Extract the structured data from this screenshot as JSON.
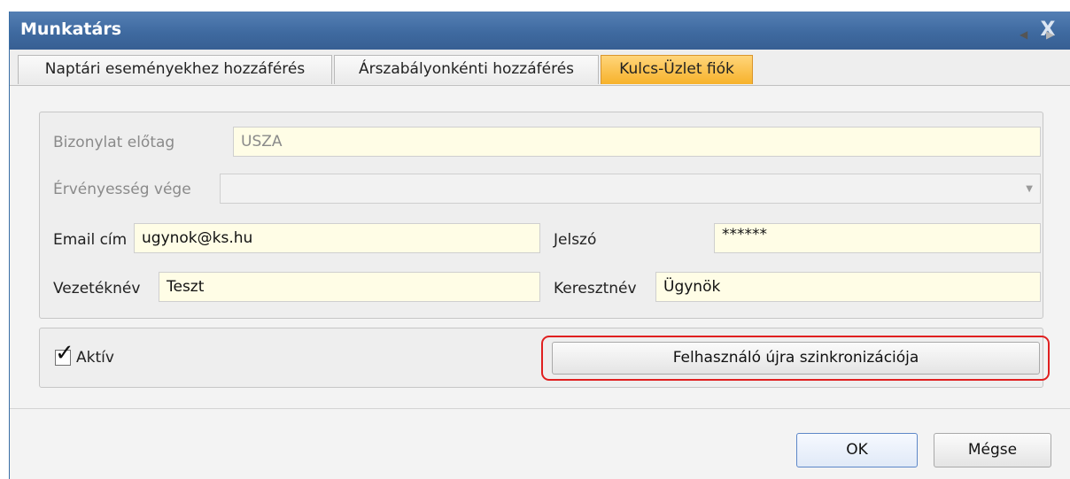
{
  "window": {
    "title": "Munkatárs",
    "close_glyph": "X"
  },
  "tabs": [
    {
      "label": "Naptári eseményekhez hozzáférés",
      "active": false
    },
    {
      "label": "Árszabályonkénti hozzáférés",
      "active": false
    },
    {
      "label": "Kulcs-Üzlet fiók",
      "active": true
    }
  ],
  "tab_nav": {
    "prev_icon": "triangle-left-icon",
    "next_icon": "triangle-right-icon",
    "prev_glyph": "◀",
    "next_glyph": "▶"
  },
  "form": {
    "prefix_label": "Bizonylat előtag",
    "prefix_value": "USZA",
    "validity_label": "Érvényesség vége",
    "validity_value": "",
    "validity_arrow": "▼",
    "email_label": "Email cím",
    "email_value": "ugynok@ks.hu",
    "password_label": "Jelszó",
    "password_value": "******",
    "lastname_label": "Vezetéknév",
    "lastname_value": "Teszt",
    "firstname_label": "Keresztnév",
    "firstname_value": "Ügynök"
  },
  "options": {
    "active_label": "Aktív",
    "active_checked": true,
    "check_glyph": "✓",
    "resync_button": "Felhasználó újra szinkronizációja"
  },
  "footer": {
    "ok_label": "OK",
    "cancel_label": "Mégse"
  },
  "colors": {
    "titlebar": "#3f6aa0",
    "active_tab": "#f7b22b",
    "field_bg": "#fffde6",
    "highlight": "#e02020"
  }
}
